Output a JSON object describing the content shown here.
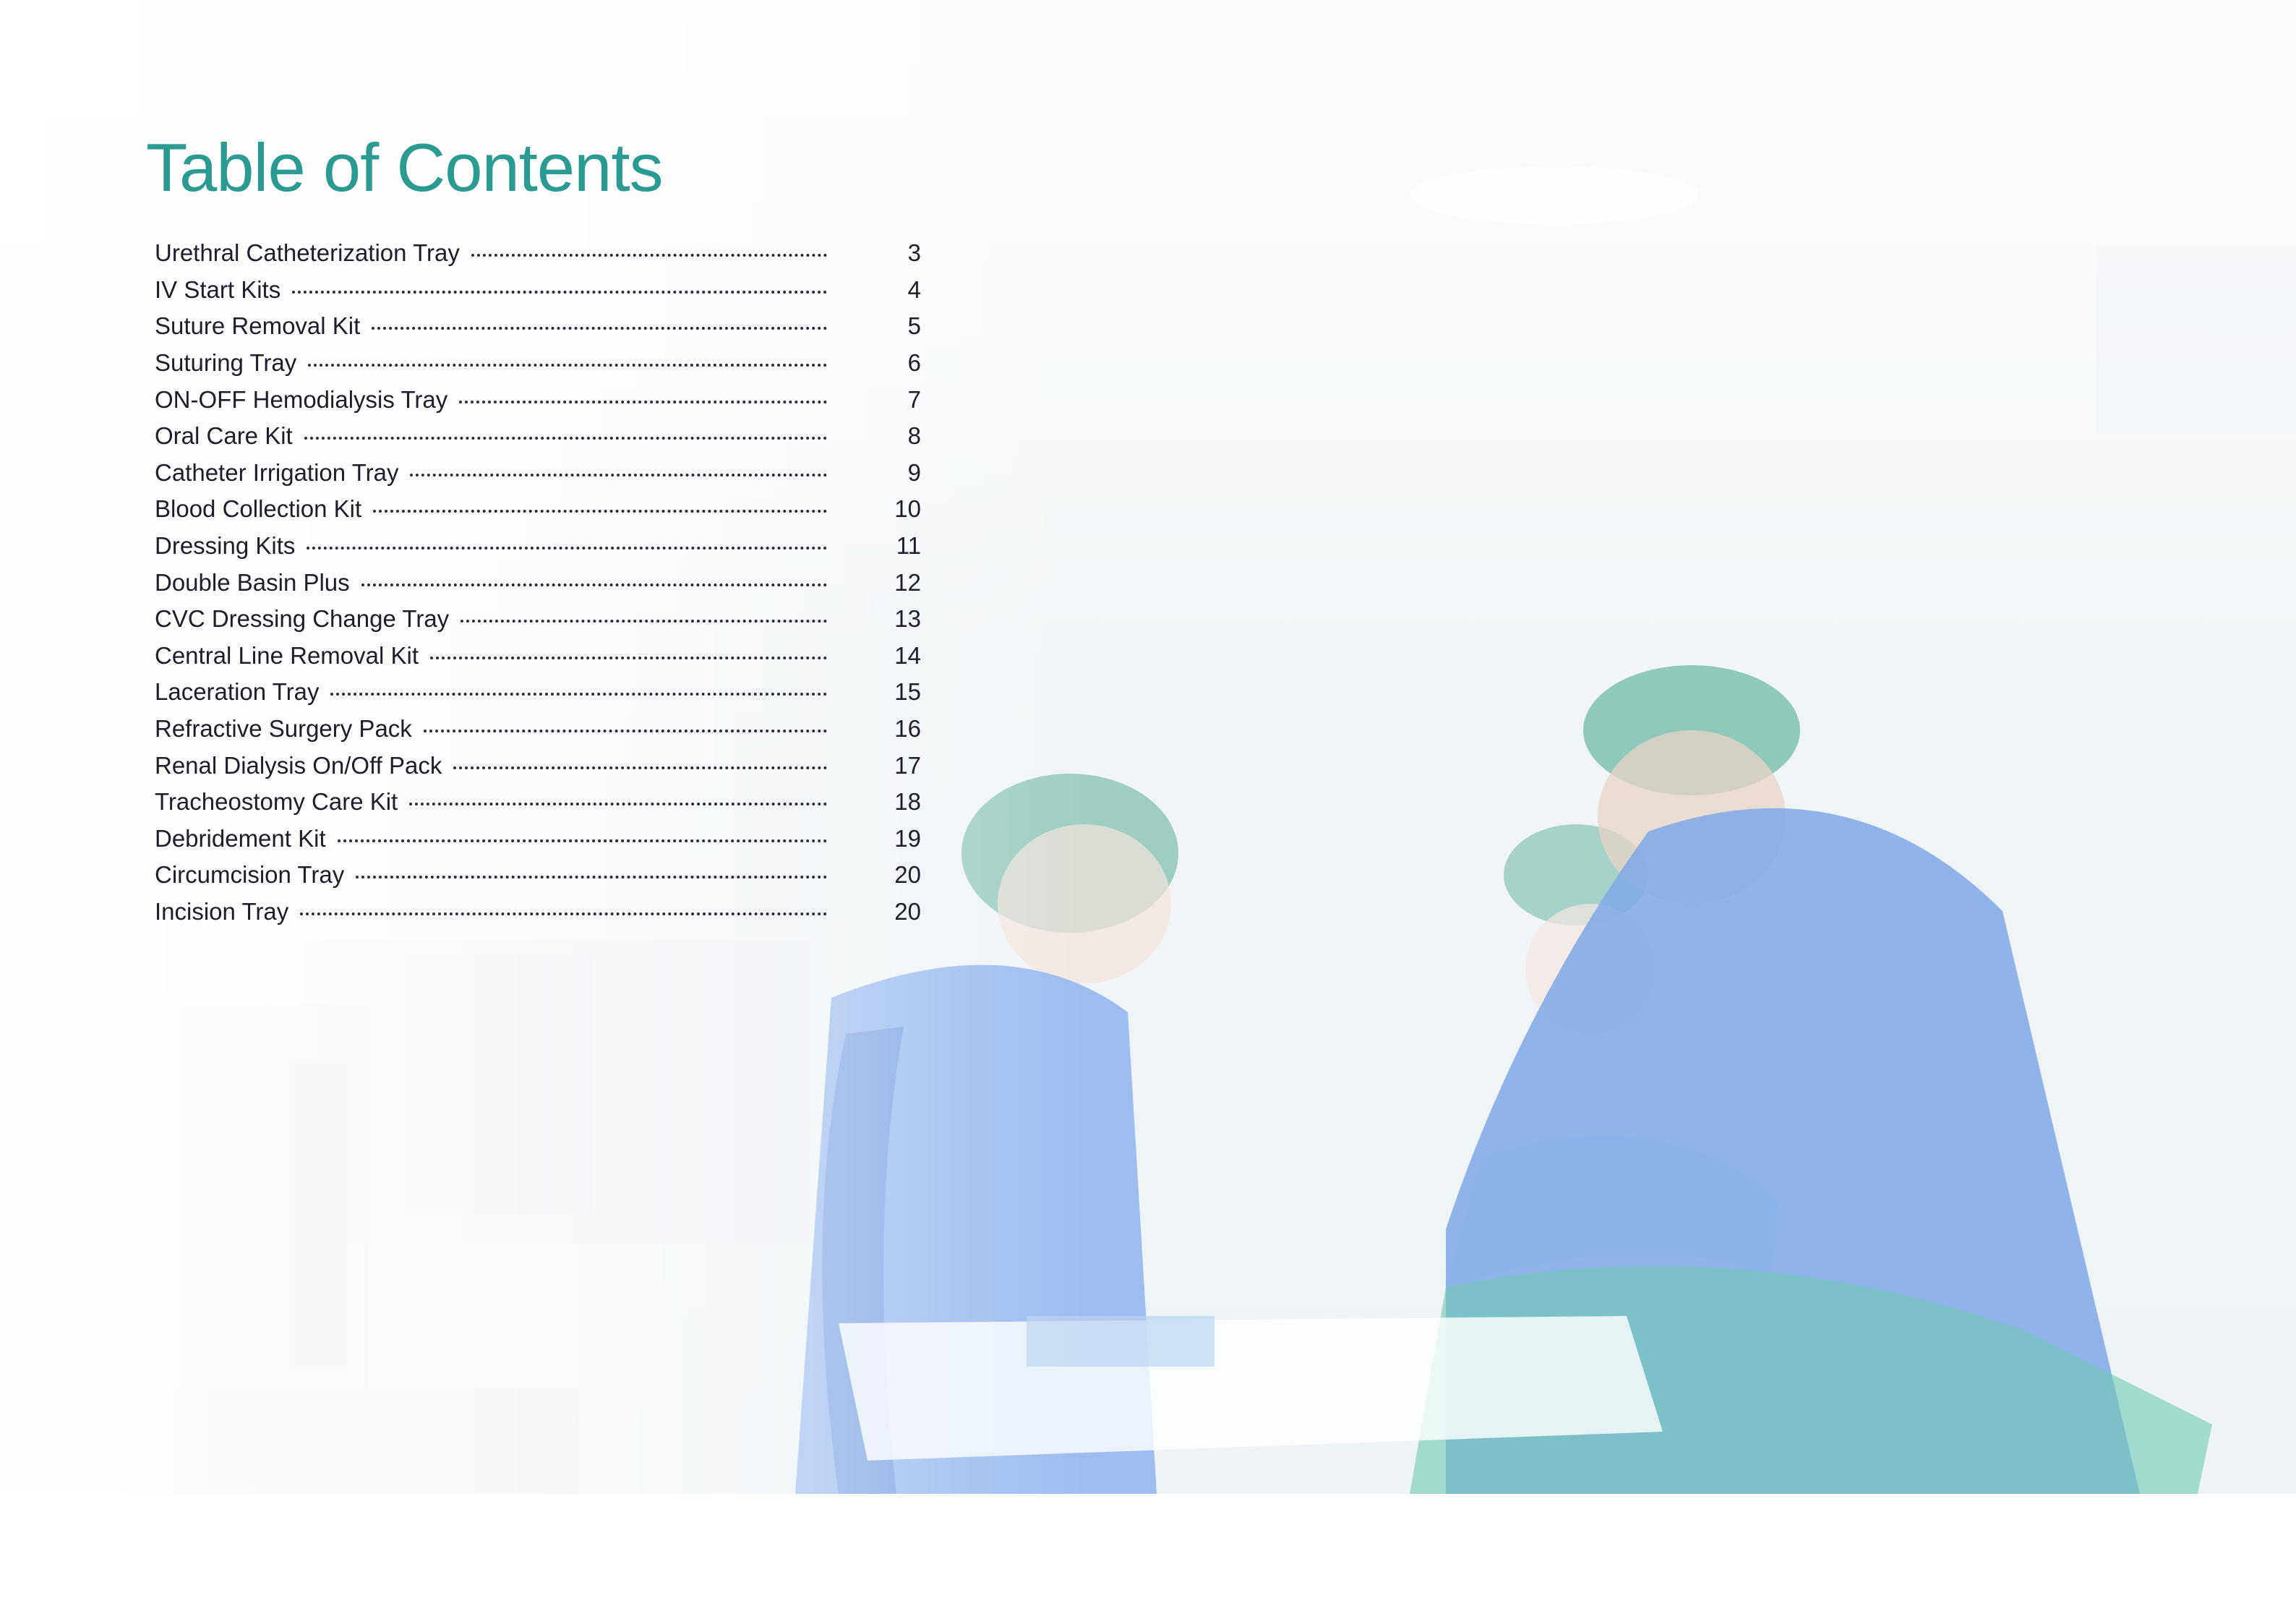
{
  "title": "Table of Contents",
  "colors": {
    "title": "#2a9a92",
    "text": "#1d1d2b",
    "scrubs": "#7fa8e6",
    "caps": "#6fb7a8"
  },
  "background_image": "surgeons-in-operating-room-photo",
  "entries": [
    {
      "label": "Urethral Catheterization Tray",
      "page": "3"
    },
    {
      "label": "IV Start Kits",
      "page": "4"
    },
    {
      "label": "Suture Removal Kit",
      "page": "5"
    },
    {
      "label": "Suturing Tray",
      "page": "6"
    },
    {
      "label": "ON-OFF Hemodialysis Tray",
      "page": "7"
    },
    {
      "label": "Oral Care Kit",
      "page": "8"
    },
    {
      "label": "Catheter Irrigation Tray",
      "page": "9"
    },
    {
      "label": "Blood Collection Kit",
      "page": "10"
    },
    {
      "label": "Dressing Kits",
      "page": "11"
    },
    {
      "label": "Double Basin Plus",
      "page": "12"
    },
    {
      "label": "CVC Dressing Change Tray",
      "page": "13"
    },
    {
      "label": "Central Line Removal Kit",
      "page": "14"
    },
    {
      "label": "Laceration Tray",
      "page": "15"
    },
    {
      "label": "Refractive Surgery Pack",
      "page": "16"
    },
    {
      "label": "Renal Dialysis On/Off Pack",
      "page": "17"
    },
    {
      "label": "Tracheostomy Care Kit",
      "page": "18"
    },
    {
      "label": "Debridement Kit",
      "page": "19"
    },
    {
      "label": "Circumcision Tray",
      "page": "20"
    },
    {
      "label": "Incision Tray",
      "page": "20"
    }
  ]
}
